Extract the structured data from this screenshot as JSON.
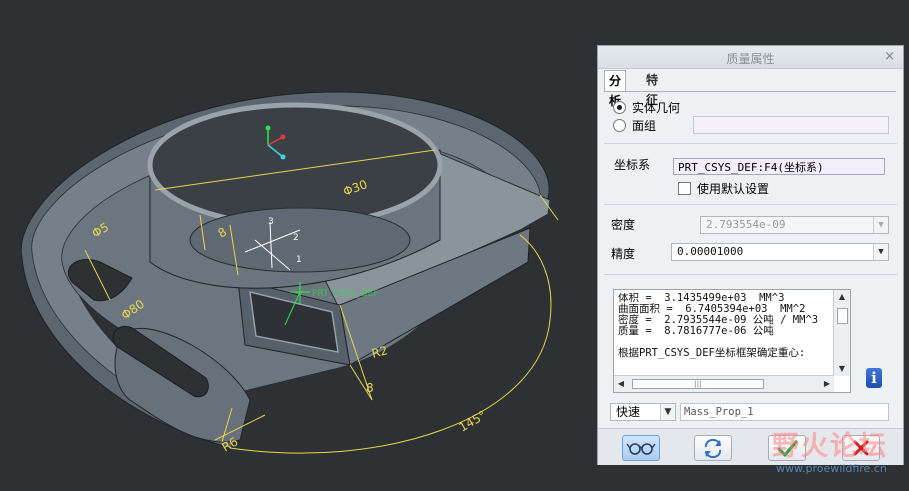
{
  "viewport": {
    "dimensions": [
      "Φ30",
      "Φ5",
      "Φ80",
      "R2",
      "8",
      "8",
      "R6",
      "145°"
    ],
    "axis_labels": [
      "3",
      "2",
      "1"
    ],
    "csys_tag": "PRT_CSYS_DEF"
  },
  "dialog": {
    "title": "质量属性",
    "close": "×",
    "tabs": [
      "分析",
      "特征"
    ],
    "geometry_options": [
      "实体几何",
      "面组"
    ],
    "selected_geometry": "实体几何",
    "csys_label": "坐标系",
    "csys_value": "PRT_CSYS_DEF:F4(坐标系)",
    "use_default_label": "使用默认设置",
    "use_default_checked": false,
    "density_label": "密度",
    "density_value": "2.793554e-09",
    "precision_label": "精度",
    "precision_value": "0.00001000",
    "results_text": "体积 =  3.1435499e+03  MM^3\n曲面面积 =  6.7405394e+03  MM^2\n密度 =  2.7935544e-09 公吨 / MM^3\n质量 =  8.7816777e-06 公吨\n\n根据PRT_CSYS_DEF坐标框架确定重心:",
    "info_icon": "i",
    "mode_value": "快速",
    "name_value": "Mass_Prop_1"
  },
  "icons": [
    "glasses-icon",
    "repeat-icon",
    "checkmark-icon",
    "x-icon"
  ],
  "watermark": {
    "title": "野火论坛",
    "url": "www.proewildfire.cn"
  },
  "colors": {
    "viewport_bg": "#2d3134",
    "dimension": "#e9d64a",
    "dialog_bg": "#eef0f4",
    "ok_green": "#1ea33a",
    "cancel_red": "#d21f1f"
  }
}
